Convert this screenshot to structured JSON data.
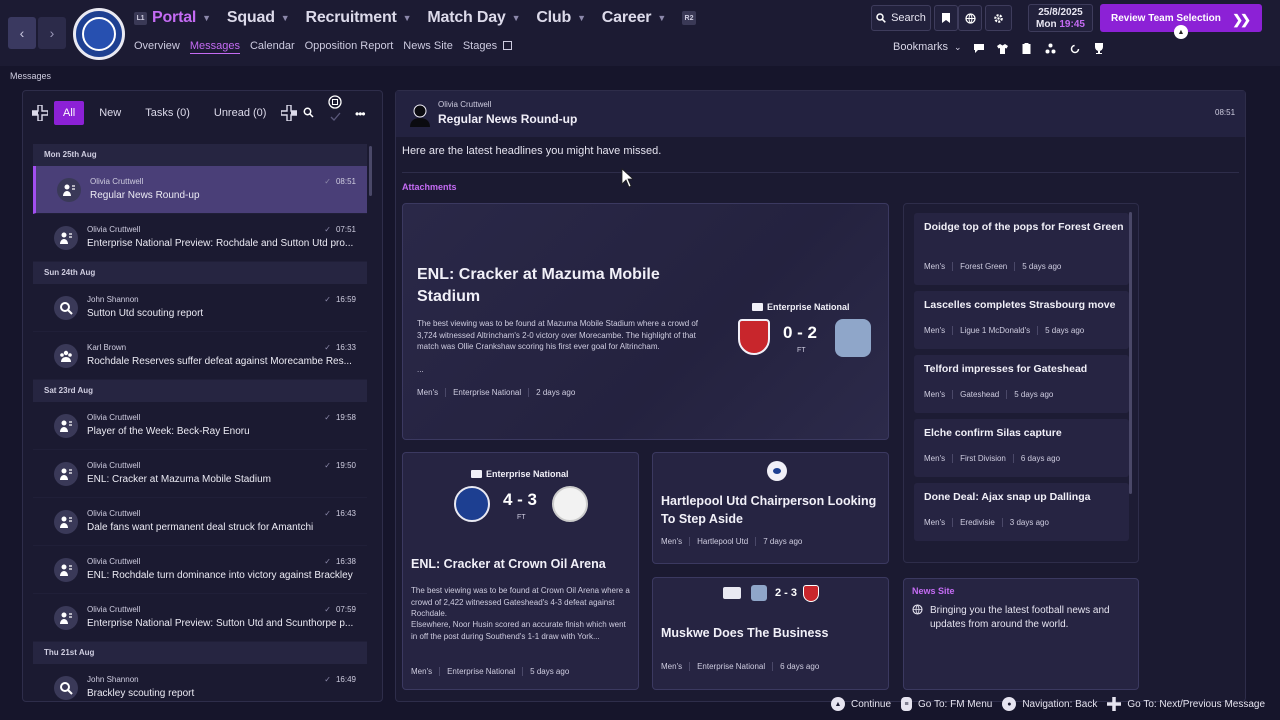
{
  "header": {
    "club_logo_text": "ROCHDALE A.F.C. THE DALE",
    "nav": [
      {
        "label": "Portal",
        "badge": "L1",
        "active": true
      },
      {
        "label": "Squad"
      },
      {
        "label": "Recruitment"
      },
      {
        "label": "Match Day"
      },
      {
        "label": "Club"
      },
      {
        "label": "Career"
      }
    ],
    "r2_badge": "R2",
    "subnav": [
      "Overview",
      "Messages",
      "Calendar",
      "Opposition Report",
      "News Site",
      "Stages"
    ],
    "search_label": "Search",
    "date": "25/8/2025",
    "day": "Mon",
    "time": "19:45",
    "review_label": "Review Team Selection",
    "bookmarks_label": "Bookmarks"
  },
  "breadcrumb": "Messages",
  "filters": {
    "all": "All",
    "new": "New",
    "tasks": "Tasks (0)",
    "unread": "Unread (0)"
  },
  "days": [
    {
      "label": "Mon 25th Aug",
      "messages": [
        {
          "from": "Olivia Cruttwell",
          "subject": "Regular News Round-up",
          "time": "08:51",
          "selected": true
        },
        {
          "from": "Olivia Cruttwell",
          "subject": "Enterprise National Preview: Rochdale and Sutton Utd pro...",
          "time": "07:51"
        }
      ]
    },
    {
      "label": "Sun 24th Aug",
      "messages": [
        {
          "from": "John Shannon",
          "subject": "Sutton Utd scouting report",
          "time": "16:59"
        },
        {
          "from": "Karl Brown",
          "subject": "Rochdale Reserves suffer defeat against Morecambe Res...",
          "time": "16:33"
        }
      ]
    },
    {
      "label": "Sat 23rd Aug",
      "messages": [
        {
          "from": "Olivia Cruttwell",
          "subject": "Player of the Week: Beck-Ray Enoru",
          "time": "19:58"
        },
        {
          "from": "Olivia Cruttwell",
          "subject": "ENL: Cracker at Mazuma Mobile Stadium",
          "time": "19:50"
        },
        {
          "from": "Olivia Cruttwell",
          "subject": "Dale fans want permanent deal struck for Amantchi",
          "time": "16:43"
        },
        {
          "from": "Olivia Cruttwell",
          "subject": "ENL: Rochdale turn dominance into victory against Brackley",
          "time": "16:38"
        },
        {
          "from": "Olivia Cruttwell",
          "subject": "Enterprise National Preview: Sutton Utd and Scunthorpe p...",
          "time": "07:59"
        }
      ]
    },
    {
      "label": "Thu 21st Aug",
      "messages": [
        {
          "from": "John Shannon",
          "subject": "Brackley scouting report",
          "time": "16:49"
        }
      ]
    }
  ],
  "message": {
    "from": "Olivia Cruttwell",
    "title": "Regular News Round-up",
    "time": "08:51",
    "body": "Here are the latest headlines you might have missed.",
    "attachments_label": "Attachments"
  },
  "featured": {
    "title": "ENL: Cracker at Mazuma Mobile Stadium",
    "desc": "The best viewing was to be found at Mazuma Mobile Stadium where a crowd of 3,724 witnessed Altrincham's 2-0 victory over Morecambe. The highlight of that match was Ollie Crankshaw scoring his first ever goal for Altrincham.",
    "ellipsis": "...",
    "competition": "Enterprise National",
    "score": "0 - 2",
    "ft": "FT",
    "meta": [
      "Men's",
      "Enterprise National",
      "2 days ago"
    ]
  },
  "card2": {
    "competition": "Enterprise National",
    "score": "4 - 3",
    "ft": "FT",
    "title": "ENL: Cracker at Crown Oil Arena",
    "desc1": "The best viewing was to be found at Crown Oil Arena where a crowd of 2,422 witnessed Gateshead's 4-3 defeat against Rochdale.",
    "desc2": "Elsewhere, Noor Husin scored an accurate finish which went in off the post during Southend's 1-1 draw with York...",
    "meta": [
      "Men's",
      "Enterprise National",
      "5 days ago"
    ]
  },
  "card3": {
    "title": "Hartlepool Utd Chairperson Looking To Step Aside",
    "meta": [
      "Men's",
      "Hartlepool Utd",
      "7 days ago"
    ]
  },
  "card4": {
    "score": "2 - 3",
    "title": "Muskwe Does The Business",
    "meta": [
      "Men's",
      "Enterprise National",
      "6 days ago"
    ]
  },
  "side_news": [
    {
      "title": "Doidge top of the pops for Forest Green",
      "meta": [
        "Men's",
        "Forest Green",
        "5 days ago"
      ]
    },
    {
      "title": "Lascelles completes Strasbourg move",
      "meta": [
        "Men's",
        "Ligue 1 McDonald's",
        "5 days ago"
      ]
    },
    {
      "title": "Telford impresses for Gateshead",
      "meta": [
        "Men's",
        "Gateshead",
        "5 days ago"
      ]
    },
    {
      "title": "Elche confirm Silas capture",
      "meta": [
        "Men's",
        "First Division",
        "6 days ago"
      ]
    },
    {
      "title": "Done Deal: Ajax snap up Dallinga",
      "meta": [
        "Men's",
        "Eredivisie",
        "3 days ago"
      ]
    }
  ],
  "news_site": {
    "label": "News Site",
    "text": "Bringing you the latest football news and updates from around the world."
  },
  "footer": {
    "continue": "Continue",
    "menu": "Go To: FM Menu",
    "back": "Navigation: Back",
    "next": "Go To: Next/Previous Message"
  },
  "colors": {
    "accent": "#8c21d6",
    "accent_text": "#c46bf3",
    "bg": "#16152b"
  }
}
